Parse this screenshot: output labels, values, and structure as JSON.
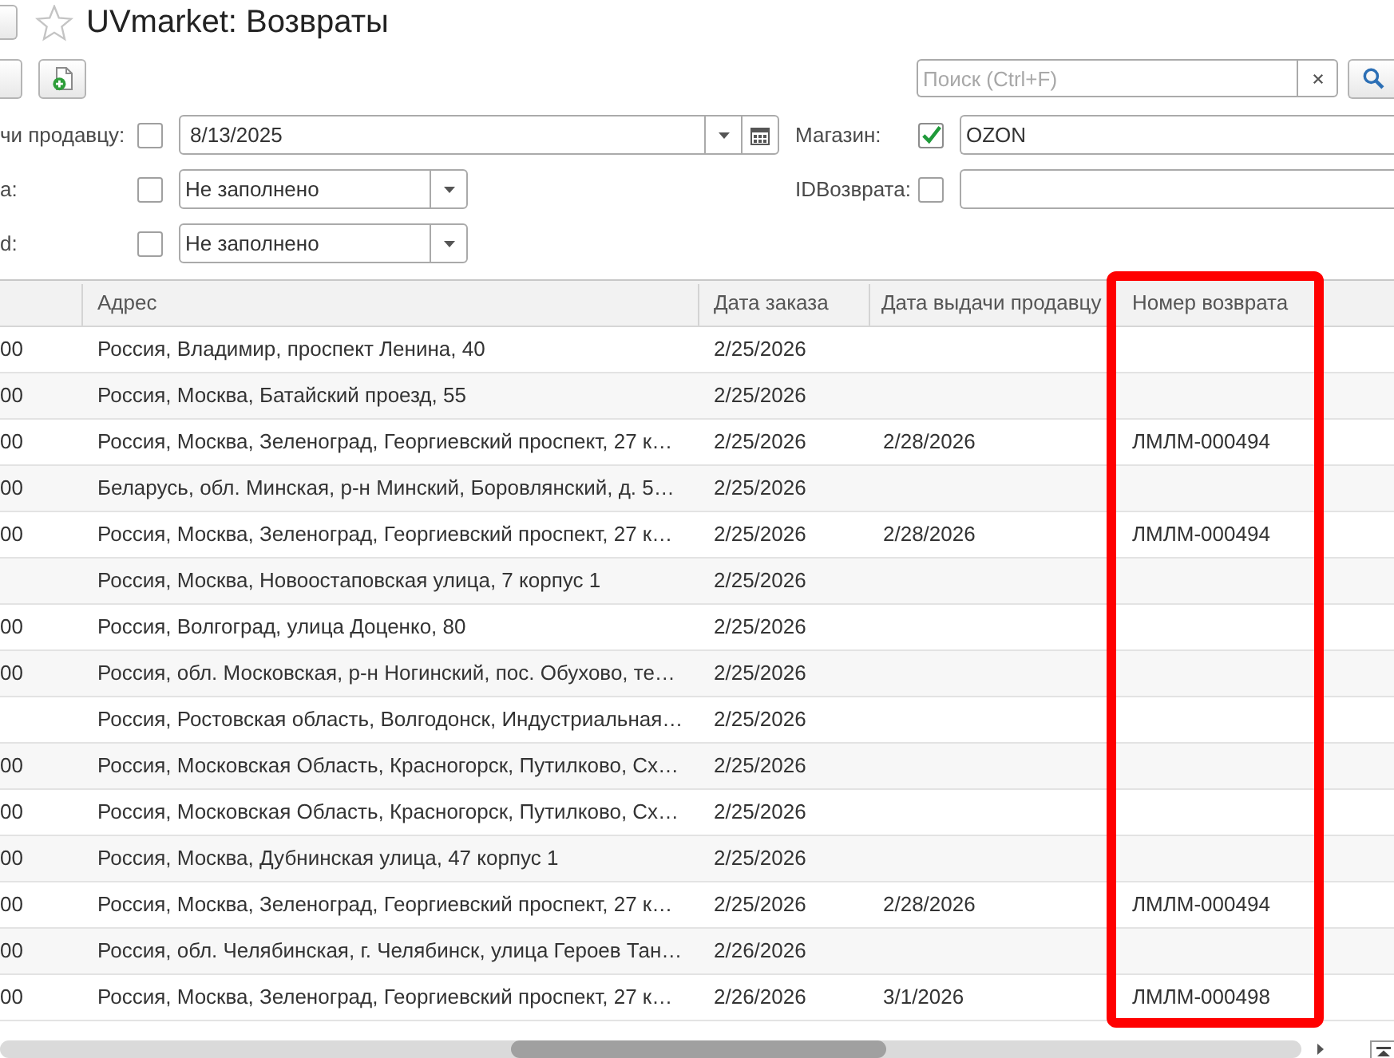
{
  "window": {
    "title": "UVmarket: Возвраты"
  },
  "toolbar": {
    "search": {
      "placeholder": "Поиск (Ctrl+F)"
    }
  },
  "filters": {
    "left": [
      {
        "kind": "date",
        "label": "чи продавцу:",
        "checked": false,
        "value": "8/13/2025"
      },
      {
        "kind": "select",
        "label": "а:",
        "checked": false,
        "value": "Не заполнено"
      },
      {
        "kind": "select",
        "label": "d:",
        "checked": false,
        "value": "Не заполнено"
      }
    ],
    "right": [
      {
        "kind": "text",
        "label": "Магазин:",
        "checked": true,
        "value": "OZON"
      },
      {
        "kind": "text",
        "label": "IDВозврата:",
        "checked": false
      }
    ]
  },
  "table": {
    "columns": [
      {},
      {
        "label": "Адрес"
      },
      {
        "label": "Дата заказа"
      },
      {
        "label": "Дата выдачи продавцу"
      },
      {
        "label": "Номер возврата",
        "highlighted": true
      }
    ],
    "rows": [
      {
        "cells": [
          "00",
          "Россия, Владимир, проспект Ленина, 40",
          "2/25/2026"
        ]
      },
      {
        "cells": [
          "00",
          "Россия, Москва, Батайский проезд, 55",
          "2/25/2026"
        ]
      },
      {
        "cells": [
          "00",
          "Россия, Москва, Зеленоград, Георгиевский проспект, 27 к…",
          "2/25/2026",
          "2/28/2026",
          "ЛМЛМ-000494"
        ]
      },
      {
        "cells": [
          "00",
          "Беларусь, обл. Минская, р-н Минский, Боровлянский, д. 5…",
          "2/25/2026"
        ]
      },
      {
        "cells": [
          "00",
          "Россия, Москва, Зеленоград, Георгиевский проспект, 27 к…",
          "2/25/2026",
          "2/28/2026",
          "ЛМЛМ-000494"
        ]
      },
      {
        "cells": [
          null,
          "Россия, Москва, Новоостаповская улица, 7 корпус 1",
          "2/25/2026"
        ]
      },
      {
        "cells": [
          "00",
          "Россия, Волгоград, улица Доценко, 80",
          "2/25/2026"
        ]
      },
      {
        "cells": [
          "00",
          "Россия, обл. Московская, р-н Ногинский, пос. Обухово, те…",
          "2/25/2026"
        ]
      },
      {
        "cells": [
          null,
          "Россия, Ростовская область, Волгодонск, Индустриальная…",
          "2/25/2026"
        ]
      },
      {
        "cells": [
          "00",
          "Россия, Московская Область, Красногорск, Путилково, Сх…",
          "2/25/2026"
        ]
      },
      {
        "cells": [
          "00",
          "Россия, Московская Область, Красногорск, Путилково, Сх…",
          "2/25/2026"
        ]
      },
      {
        "cells": [
          "00",
          "Россия, Москва, Дубнинская улица, 47 корпус 1",
          "2/25/2026"
        ]
      },
      {
        "cells": [
          "00",
          "Россия, Москва, Зеленоград, Георгиевский проспект, 27 к…",
          "2/25/2026",
          "2/28/2026",
          "ЛМЛМ-000494"
        ]
      },
      {
        "cells": [
          "00",
          "Россия, обл. Челябинская, г. Челябинск, улица Героев Тан…",
          "2/26/2026"
        ]
      },
      {
        "cells": [
          "00",
          "Россия, Москва, Зеленоград, Георгиевский проспект, 27 к…",
          "2/26/2026",
          "3/1/2026",
          "ЛМЛМ-000498"
        ]
      }
    ]
  }
}
